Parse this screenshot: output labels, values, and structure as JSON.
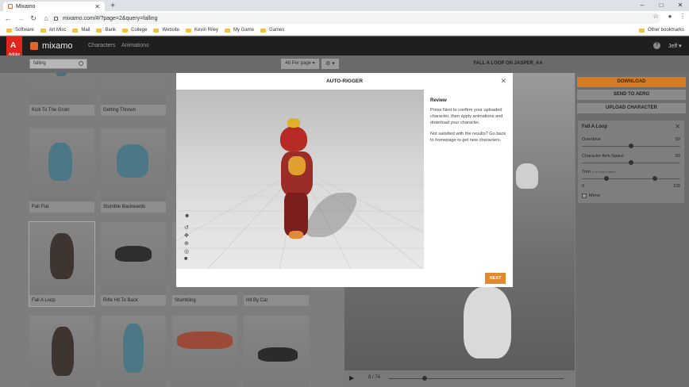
{
  "browser": {
    "tab_title": "Mixamo",
    "new_tab": "+",
    "url": "mixamo.com/#/?page=2&query=falling",
    "window_controls": [
      "–",
      "□",
      "✕"
    ],
    "bookmarks": [
      "Software",
      "Art Misc",
      "Mail",
      "Bank",
      "College",
      "Website",
      "Kevin Riley",
      "My Game",
      "Games"
    ],
    "other_bookmarks": "Other bookmarks"
  },
  "app": {
    "adobe_label": "Adobe",
    "logo": "mixamo",
    "nav": [
      "Characters",
      "Animations"
    ],
    "help": "?",
    "user": "Jeff ▾"
  },
  "toolbar": {
    "search_value": "falling",
    "per_page": "48 Per page",
    "gear": "⚙ ▾",
    "animation_title": "FALL A LOOP ON JASPER_AA"
  },
  "grid": {
    "cards": [
      {
        "label": "Kick To The Groin"
      },
      {
        "label": "Getting Thrown"
      },
      {
        "label": "Fall Flat"
      },
      {
        "label": "Stumble Backwards"
      },
      {
        "label": "Fall A Loop"
      },
      {
        "label": "Rifle Hit To Back"
      },
      {
        "label": "Stumbling"
      },
      {
        "label": "Hit By Car"
      },
      {
        "label": ""
      },
      {
        "label": ""
      },
      {
        "label": ""
      },
      {
        "label": ""
      }
    ]
  },
  "side": {
    "download": "DOWNLOAD",
    "send_to_aero": "SEND TO AERO",
    "upload": "UPLOAD CHARACTER",
    "panel_title": "Fall A Loop",
    "params": [
      {
        "label": "Overdrive",
        "value": "50",
        "fraction": 0.5
      },
      {
        "label": "Character Arm-Space",
        "value": "50",
        "fraction": 0.5
      }
    ],
    "trim_label": "Trim",
    "trim_hint": "% of total frames",
    "trim_min": "0",
    "trim_max": "100",
    "mirror": "Mirror"
  },
  "player": {
    "frame": "8 / 74"
  },
  "modal": {
    "title": "AUTO-RIGGER",
    "review_heading": "Review",
    "review_p1": "Press Next to confirm your uploaded character, then apply animations and download your character.",
    "review_p2": "Not satisfied with the results? Go back to homepage to get new characters.",
    "next": "NEXT"
  },
  "colors": {
    "accent": "#e38a2f",
    "header": "#1f1f1f",
    "adobe_red": "#e1251b"
  }
}
